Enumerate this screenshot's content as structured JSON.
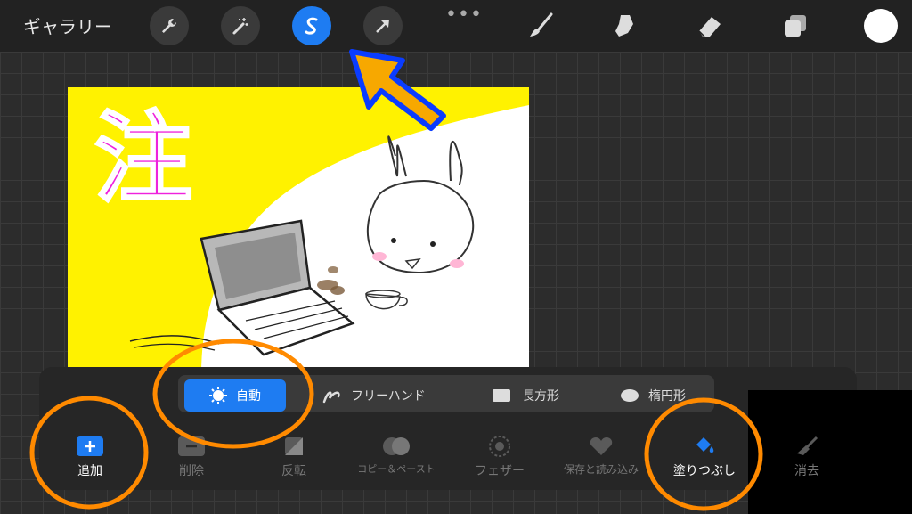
{
  "topbar": {
    "gallery_label": "ギャラリー",
    "tools": [
      {
        "name": "actions",
        "icon": "wrench-icon"
      },
      {
        "name": "adjustments",
        "icon": "magic-wand-icon"
      },
      {
        "name": "selection",
        "icon": "selection-s-icon",
        "active": true
      },
      {
        "name": "transform",
        "icon": "arrow-cursor-icon"
      }
    ],
    "more_label": "•••",
    "right_tools": [
      "brush-icon",
      "smudge-icon",
      "eraser-icon",
      "layers-icon"
    ],
    "current_color": "#ffffff"
  },
  "artwork": {
    "caption_char": "注"
  },
  "selection_modes": [
    {
      "label": "自動",
      "icon": "sun-icon",
      "selected": true
    },
    {
      "label": "フリーハンド",
      "icon": "freehand-icon"
    },
    {
      "label": "長方形",
      "icon": "rectangle-icon"
    },
    {
      "label": "楕円形",
      "icon": "ellipse-icon"
    }
  ],
  "actions": [
    {
      "label": "追加",
      "icon": "plus-icon",
      "enabled": true
    },
    {
      "label": "削除",
      "icon": "minus-icon"
    },
    {
      "label": "反転",
      "icon": "invert-icon"
    },
    {
      "label": "コピー＆ペースト",
      "icon": "copy-paste-icon"
    },
    {
      "label": "フェザー",
      "icon": "feather-icon"
    },
    {
      "label": "保存と読み込み",
      "icon": "heart-icon"
    },
    {
      "label": "塗りつぶし",
      "icon": "fill-bucket-icon",
      "enabled": true
    },
    {
      "label": "消去",
      "icon": "broom-icon"
    }
  ],
  "colors": {
    "accent": "#1e7cf2",
    "highlight_orange": "#ff8a00",
    "annotation_yellow": "#f7a800",
    "annotation_blue": "#0a3cff"
  }
}
